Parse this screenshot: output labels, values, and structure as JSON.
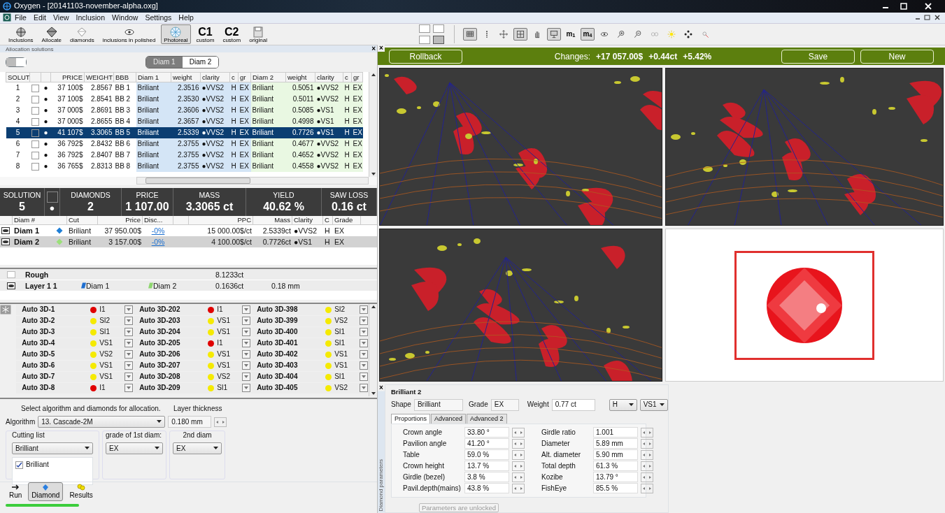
{
  "window": {
    "title": "Oxygen - [20141103-november-alpha.oxg]"
  },
  "menu": [
    "File",
    "Edit",
    "View",
    "Inclusion",
    "Window",
    "Settings",
    "Help"
  ],
  "toolbar": [
    {
      "label": "Inclusions",
      "selected": false
    },
    {
      "label": "Allocate",
      "selected": false
    },
    {
      "label": "diamonds",
      "selected": false
    },
    {
      "label": "inclusions in polished",
      "selected": false
    },
    {
      "label": "Photoreal",
      "selected": true
    },
    {
      "big": "C1",
      "label": "custom",
      "selected": false
    },
    {
      "big": "C2",
      "label": "custom",
      "selected": false
    },
    {
      "label": "original",
      "selected": false
    }
  ],
  "layout_buttons": [
    {
      "selected": false
    },
    {
      "selected": false
    },
    {
      "selected": false
    },
    {
      "selected": true
    }
  ],
  "view_tools": [
    {
      "pressed": true
    },
    {
      "pressed": false
    },
    {
      "pressed": false
    },
    {
      "pressed": true
    },
    {
      "pressed": false
    },
    {
      "pressed": true
    },
    {
      "label": "m$_{1}$",
      "pressed": false
    },
    {
      "label": "m$_{4}$",
      "pressed": true
    },
    {
      "pressed": false
    },
    {
      "pressed": false
    },
    {
      "pressed": false
    },
    {
      "pressed": false
    },
    {
      "pressed": false
    },
    {
      "pressed": false
    },
    {
      "pressed": false
    }
  ],
  "allocation": {
    "title": "Allocation solutions",
    "close": "×",
    "list_views": [
      {
        "selected": true
      },
      {
        "selected": false
      }
    ],
    "diam_tabs": [
      {
        "label": "Diam 1",
        "selected": true
      },
      {
        "label": "Diam 2",
        "selected": false
      }
    ],
    "table": {
      "columns": [
        "SOLUT",
        "PRICE",
        "WEIGHT",
        "BBB",
        "Diam 1",
        "weight",
        "clarity",
        "c",
        "gr",
        "Diam 2",
        "weight",
        "clarity",
        "c",
        "gr"
      ],
      "rows": [
        {
          "solut": "1",
          "checked": false,
          "dot": "●",
          "price": "37 100$",
          "weight": "2.8567",
          "bbb": "BB 1",
          "d1": [
            "Briliant",
            "2.3516",
            "●VVS2",
            "H",
            "EX"
          ],
          "d2": [
            "Briliant",
            "0.5051",
            "●VVS2",
            "H",
            "EX"
          ],
          "selected": false
        },
        {
          "solut": "2",
          "checked": false,
          "dot": "●",
          "price": "37 100$",
          "weight": "2.8541",
          "bbb": "BB 2",
          "d1": [
            "Briliant",
            "2.3530",
            "●VVS2",
            "H",
            "EX"
          ],
          "d2": [
            "Briliant",
            "0.5011",
            "●VVS2",
            "H",
            "EX"
          ],
          "selected": false
        },
        {
          "solut": "3",
          "checked": false,
          "dot": "●",
          "price": "37 000$",
          "weight": "2.8691",
          "bbb": "BB 3",
          "d1": [
            "Briliant",
            "2.3606",
            "●VVS2",
            "H",
            "EX"
          ],
          "d2": [
            "Briliant",
            "0.5085",
            "●VS1",
            "H",
            "EX"
          ],
          "selected": false
        },
        {
          "solut": "4",
          "checked": false,
          "dot": "●",
          "price": "37 000$",
          "weight": "2.8655",
          "bbb": "BB 4",
          "d1": [
            "Briliant",
            "2.3657",
            "●VVS2",
            "H",
            "EX"
          ],
          "d2": [
            "Briliant",
            "0.4998",
            "●VS1",
            "H",
            "EX"
          ],
          "selected": false
        },
        {
          "solut": "5",
          "checked": false,
          "dot": "●",
          "price": "41 107$",
          "weight": "3.3065",
          "bbb": "BB 5",
          "d1": [
            "Briliant",
            "2.5339",
            "●VVS2",
            "H",
            "EX"
          ],
          "d2": [
            "Briliant",
            "0.7726",
            "●VS1",
            "H",
            "EX"
          ],
          "selected": true
        },
        {
          "solut": "6",
          "checked": false,
          "dot": "●",
          "price": "36 792$",
          "weight": "2.8432",
          "bbb": "BB 6",
          "d1": [
            "Briliant",
            "2.3755",
            "●VVS2",
            "H",
            "EX"
          ],
          "d2": [
            "Briliant",
            "0.4677",
            "●VVS2",
            "H",
            "EX"
          ],
          "selected": false
        },
        {
          "solut": "7",
          "checked": false,
          "dot": "●",
          "price": "36 792$",
          "weight": "2.8407",
          "bbb": "BB 7",
          "d1": [
            "Briliant",
            "2.3755",
            "●VVS2",
            "H",
            "EX"
          ],
          "d2": [
            "Briliant",
            "0.4652",
            "●VVS2",
            "H",
            "EX"
          ],
          "selected": false
        },
        {
          "solut": "8",
          "checked": false,
          "dot": "●",
          "price": "36 765$",
          "weight": "2.8313",
          "bbb": "BB 8",
          "d1": [
            "Briliant",
            "2.3755",
            "●VVS2",
            "H",
            "EX"
          ],
          "d2": [
            "Briliant",
            "0.4558",
            "●VVS2",
            "H",
            "EX"
          ],
          "selected": false
        }
      ]
    },
    "summary": {
      "solution": {
        "label": "SOLUTION",
        "value": "5"
      },
      "checked": false,
      "dot": "●",
      "items": [
        {
          "label": "DIAMONDS",
          "value": "2"
        },
        {
          "label": "PRICE",
          "value": "1 107.00"
        },
        {
          "label": "MASS",
          "value": "3.3065 ct"
        },
        {
          "label": "YIELD",
          "value": "40.62 %"
        },
        {
          "label": "SAW LOSS",
          "value": "0.16 ct"
        }
      ]
    },
    "diamonds": {
      "columns": [
        "Diam #",
        "Cut",
        "Price",
        "Disc...",
        "PPC",
        "Mass",
        "Clarity",
        "C",
        "Grade"
      ],
      "rows": [
        {
          "name": "Diam 1",
          "color": "#1f7fd6",
          "cut": "Briliant",
          "price": "37 950.00$",
          "discount": "-0%",
          "ppc": "15 000.00$/ct",
          "mass": "2.5339ct",
          "clarity": "●VVS2",
          "c": "H",
          "grade": "EX",
          "selected": false
        },
        {
          "name": "Diam 2",
          "color": "#9be07a",
          "cut": "Briliant",
          "price": "3 157.00$",
          "discount": "-0%",
          "ppc": "4 100.00$/ct",
          "mass": "0.7726ct",
          "clarity": "●VS1",
          "c": "H",
          "grade": "EX",
          "selected": true
        }
      ]
    },
    "rough": {
      "name": "Rough",
      "mass": "8.1233ct"
    },
    "layer": {
      "name": "Layer 1 1",
      "tags": [
        {
          "label": "Diam 1",
          "color": "#1f6fd0"
        },
        {
          "label": "Diam 2",
          "color": "#8fd670"
        }
      ],
      "mass": "0.1636ct",
      "thickness": "0.18 mm"
    },
    "inclusions": [
      [
        {
          "name": "Auto 3D-1",
          "clarity": "I1",
          "color": "#e00000"
        },
        {
          "name": "Auto 3D-202",
          "clarity": "I1",
          "color": "#e00000"
        },
        {
          "name": "Auto 3D-398",
          "clarity": "SI2",
          "color": "#f5ea00"
        }
      ],
      [
        {
          "name": "Auto 3D-2",
          "clarity": "SI2",
          "color": "#f5ea00"
        },
        {
          "name": "Auto 3D-203",
          "clarity": "VS1",
          "color": "#f5ea00"
        },
        {
          "name": "Auto 3D-399",
          "clarity": "VS2",
          "color": "#f5ea00"
        }
      ],
      [
        {
          "name": "Auto 3D-3",
          "clarity": "SI1",
          "color": "#f5ea00"
        },
        {
          "name": "Auto 3D-204",
          "clarity": "VS1",
          "color": "#f5ea00"
        },
        {
          "name": "Auto 3D-400",
          "clarity": "SI1",
          "color": "#f5ea00"
        }
      ],
      [
        {
          "name": "Auto 3D-4",
          "clarity": "VS1",
          "color": "#f5ea00"
        },
        {
          "name": "Auto 3D-205",
          "clarity": "I1",
          "color": "#e00000"
        },
        {
          "name": "Auto 3D-401",
          "clarity": "SI1",
          "color": "#f5ea00"
        }
      ],
      [
        {
          "name": "Auto 3D-5",
          "clarity": "VS2",
          "color": "#f5ea00"
        },
        {
          "name": "Auto 3D-206",
          "clarity": "VS1",
          "color": "#f5ea00"
        },
        {
          "name": "Auto 3D-402",
          "clarity": "VS1",
          "color": "#f5ea00"
        }
      ],
      [
        {
          "name": "Auto 3D-6",
          "clarity": "VS1",
          "color": "#f5ea00"
        },
        {
          "name": "Auto 3D-207",
          "clarity": "VS1",
          "color": "#f5ea00"
        },
        {
          "name": "Auto 3D-403",
          "clarity": "VS1",
          "color": "#f5ea00"
        }
      ],
      [
        {
          "name": "Auto 3D-7",
          "clarity": "VS1",
          "color": "#f5ea00"
        },
        {
          "name": "Auto 3D-208",
          "clarity": "VS2",
          "color": "#f5ea00"
        },
        {
          "name": "Auto 3D-404",
          "clarity": "SI1",
          "color": "#f5ea00"
        }
      ],
      [
        {
          "name": "Auto 3D-8",
          "clarity": "I1",
          "color": "#e00000"
        },
        {
          "name": "Auto 3D-209",
          "clarity": "SI1",
          "color": "#f5ea00"
        },
        {
          "name": "Auto 3D-405",
          "clarity": "VS2",
          "color": "#f5ea00"
        }
      ]
    ],
    "form": {
      "hint": "Select algorithm and diamonds for allocation.",
      "layer_label": "Layer thickness",
      "algorithm_label": "Algorithm",
      "algorithm": "13. Cascade-2M",
      "layer_value": "0.180 mm",
      "cutting_label": "Cutting list",
      "cutting": "Brilliant",
      "cuts": [
        {
          "label": "Brilliant",
          "checked": true
        }
      ],
      "grade1_label": "grade of 1st diam:",
      "grade1": "EX",
      "grade2_label": "2nd diam",
      "grade2": "EX"
    },
    "modes": [
      {
        "label": "Run",
        "selected": false
      },
      {
        "label": "Diamond",
        "selected": true
      },
      {
        "label": "Results",
        "selected": false
      }
    ],
    "progress": {
      "level": 1
    }
  },
  "changes": {
    "close": "×",
    "rollback": "Rollback",
    "label": "Changes:",
    "values": [
      "+17 057.00$",
      "+0.44ct",
      "+5.42%"
    ],
    "buttons": [
      "Save",
      "New"
    ]
  },
  "params": {
    "side_tab": "Diamond parameters",
    "group": "Brilliant 2",
    "shape_label": "Shape",
    "shape": "Brilliant",
    "grade_label": "Grade",
    "grade": "EX",
    "weight_label": "Weight",
    "weight": "0.77 ct",
    "color_grade": "H",
    "close": "×",
    "clarity": "VS1",
    "tabs": [
      {
        "label": "Proportions",
        "selected": true
      },
      {
        "label": "Advanced",
        "selected": false
      },
      {
        "label": "Advanced 2",
        "selected": false
      }
    ],
    "left": [
      {
        "label": "Crown angle",
        "value": "33.80 °"
      },
      {
        "label": "Pavilion angle",
        "value": "41.20 °"
      },
      {
        "label": "Table",
        "value": "59.0 %"
      },
      {
        "label": "Crown height",
        "value": "13.7 %"
      },
      {
        "label": "Girdle (bezel)",
        "value": "3.8 %"
      },
      {
        "label": "Pavil.depth(mains)",
        "value": "43.8 %"
      }
    ],
    "right": [
      {
        "label": "Girdle ratio",
        "value": "1.001"
      },
      {
        "label": "Diameter",
        "value": "5.89 mm"
      },
      {
        "label": "Alt. diameter",
        "value": "5.90 mm"
      },
      {
        "label": "Total depth",
        "value": "61.3 %"
      },
      {
        "label": "Kozibe",
        "value": "13.79 °"
      },
      {
        "label": "FishEye",
        "value": "85.5 %"
      }
    ],
    "lock_button": "Parameters are unlocked",
    "lock_disabled": true
  }
}
